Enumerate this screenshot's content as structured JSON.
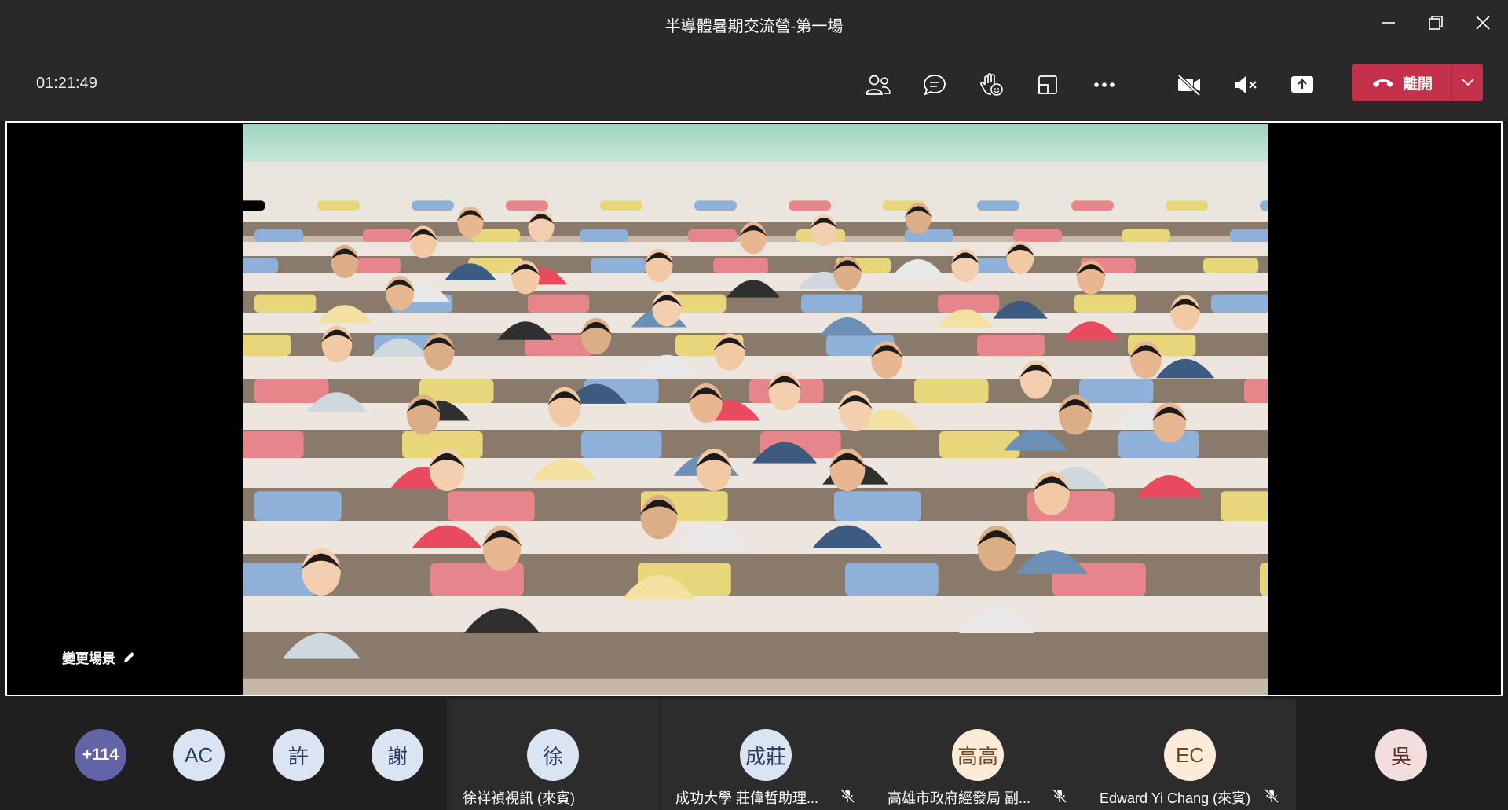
{
  "window": {
    "title": "半導體暑期交流營-第一場"
  },
  "toolbar": {
    "timer": "01:21:49",
    "leave_label": "離開"
  },
  "stage": {
    "change_scene_label": "變更場景"
  },
  "participants": {
    "overflow": "+114",
    "avatars": [
      {
        "initials": "AC"
      },
      {
        "initials": "許"
      },
      {
        "initials": "謝"
      }
    ],
    "tiles": [
      {
        "initials": "徐",
        "name": "徐祥禎視訊 (來賓)"
      },
      {
        "initials": "成莊",
        "name": "成功大學 莊偉哲助理..."
      },
      {
        "initials": "高高",
        "name": "高雄市政府經發局 副..."
      },
      {
        "initials": "EC",
        "name": "Edward Yi Chang (來賓)"
      }
    ],
    "last": {
      "initials": "吳"
    }
  },
  "colors": {
    "leave": "#c4314b",
    "overflow": "#6264a7",
    "avatar_blue": "#dae4f2",
    "avatar_peach": "#fcebd9",
    "avatar_pink": "#f3dede"
  }
}
